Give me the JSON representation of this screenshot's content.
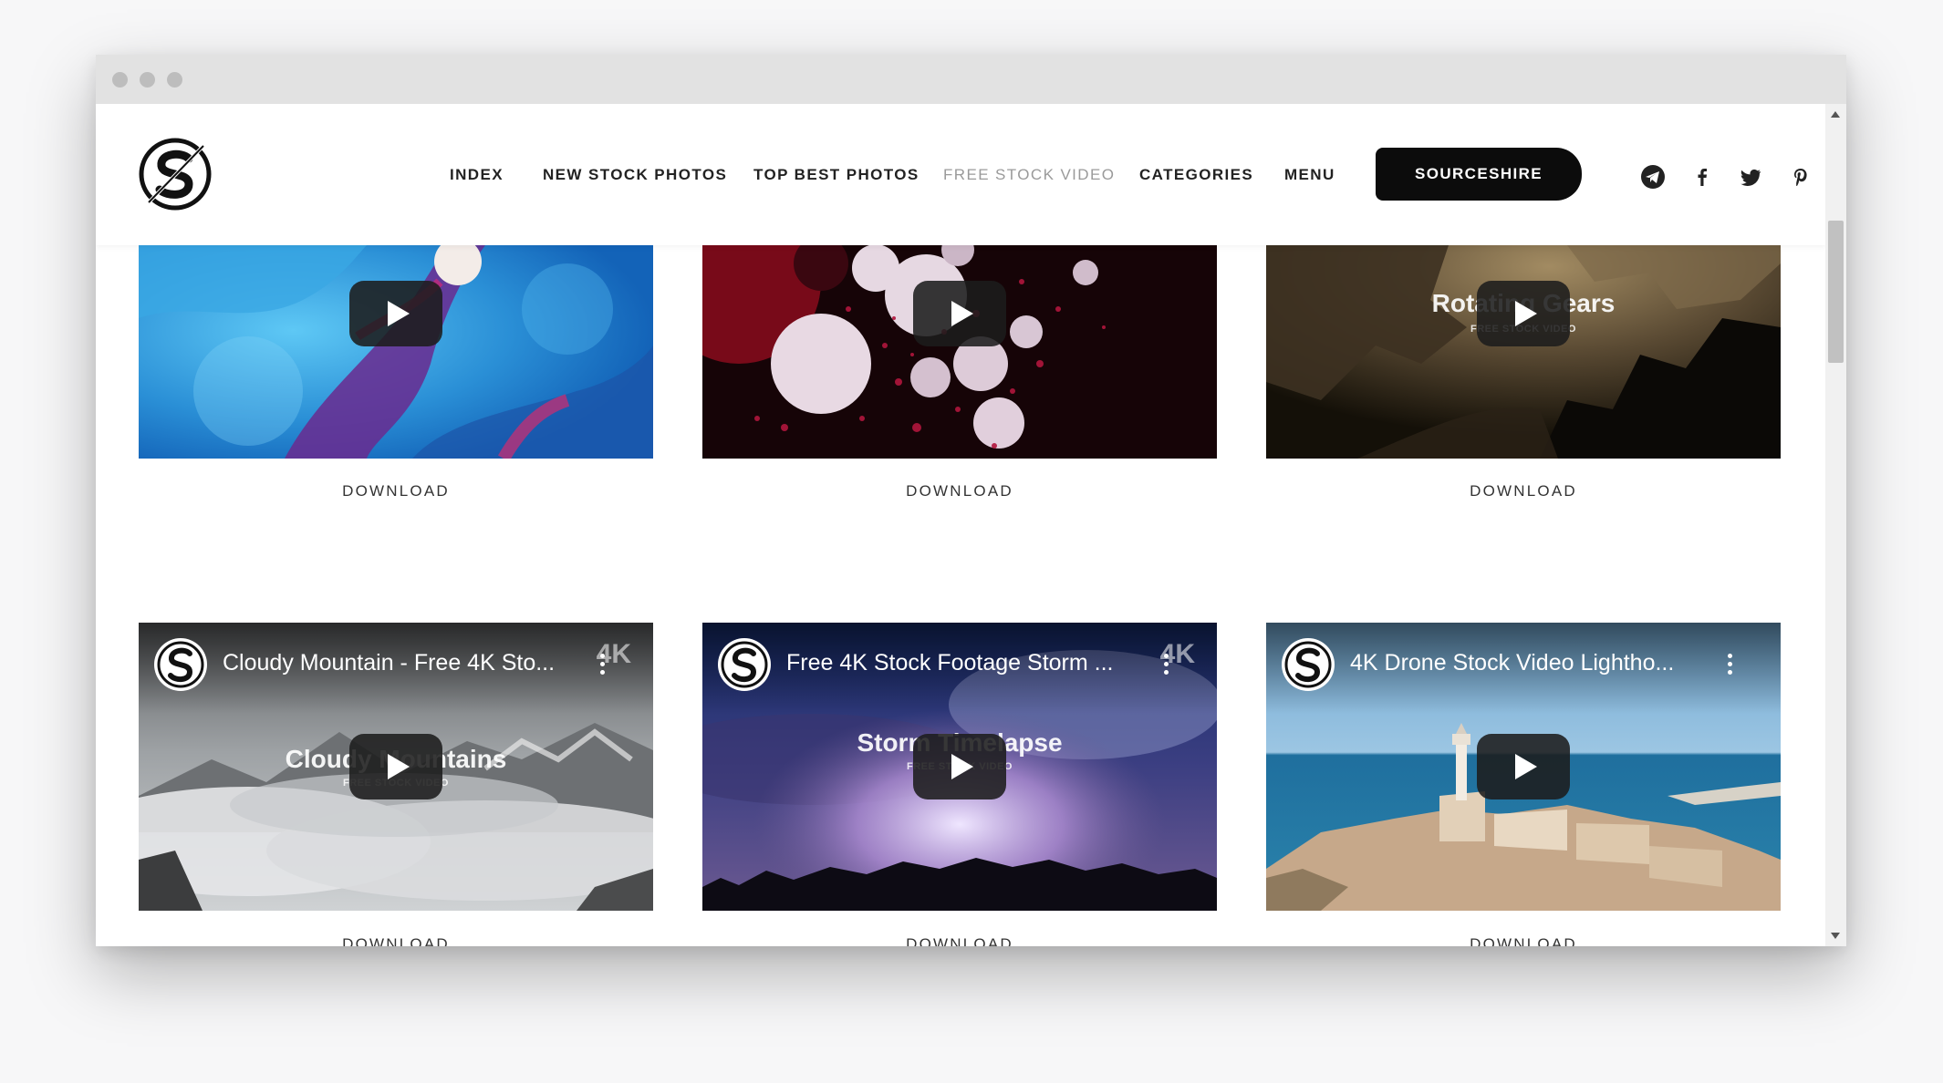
{
  "nav": {
    "items": [
      {
        "label": "INDEX",
        "active": false
      },
      {
        "label": "NEW STOCK PHOTOS",
        "active": false
      },
      {
        "label": "TOP BEST PHOTOS",
        "active": false
      },
      {
        "label": "FREE STOCK VIDEO",
        "active": true
      },
      {
        "label": "CATEGORIES",
        "active": false
      },
      {
        "label": "MENU",
        "active": false
      }
    ],
    "cta_label": "SOURCESHIRE"
  },
  "social_icons": [
    "telegram-icon",
    "facebook-icon",
    "twitter-icon",
    "pinterest-icon"
  ],
  "colors": {
    "accent": "#0c0c0c",
    "nav_active": "#9a9a9a",
    "titlebar": "#e2e2e2"
  },
  "videos": [
    {
      "download_label": "DOWNLOAD"
    },
    {
      "download_label": "DOWNLOAD"
    },
    {
      "overlay_title": "Rotating Gears",
      "overlay_sub": "FREE STOCK VIDEO",
      "download_label": "DOWNLOAD"
    },
    {
      "yt_title": "Cloudy Mountain - Free 4K Sto...",
      "badge": "4K",
      "overlay_title": "Cloudy Mountains",
      "overlay_sub": "FREE STOCK VIDEO",
      "download_label": "DOWNLOAD"
    },
    {
      "yt_title": "Free 4K Stock Footage Storm ...",
      "badge": "4K",
      "overlay_title": "Storm Timelapse",
      "overlay_sub": "FREE STOCK VIDEO",
      "download_label": "DOWNLOAD"
    },
    {
      "yt_title": "4K Drone Stock Video Lightho...",
      "download_label": "DOWNLOAD"
    }
  ]
}
